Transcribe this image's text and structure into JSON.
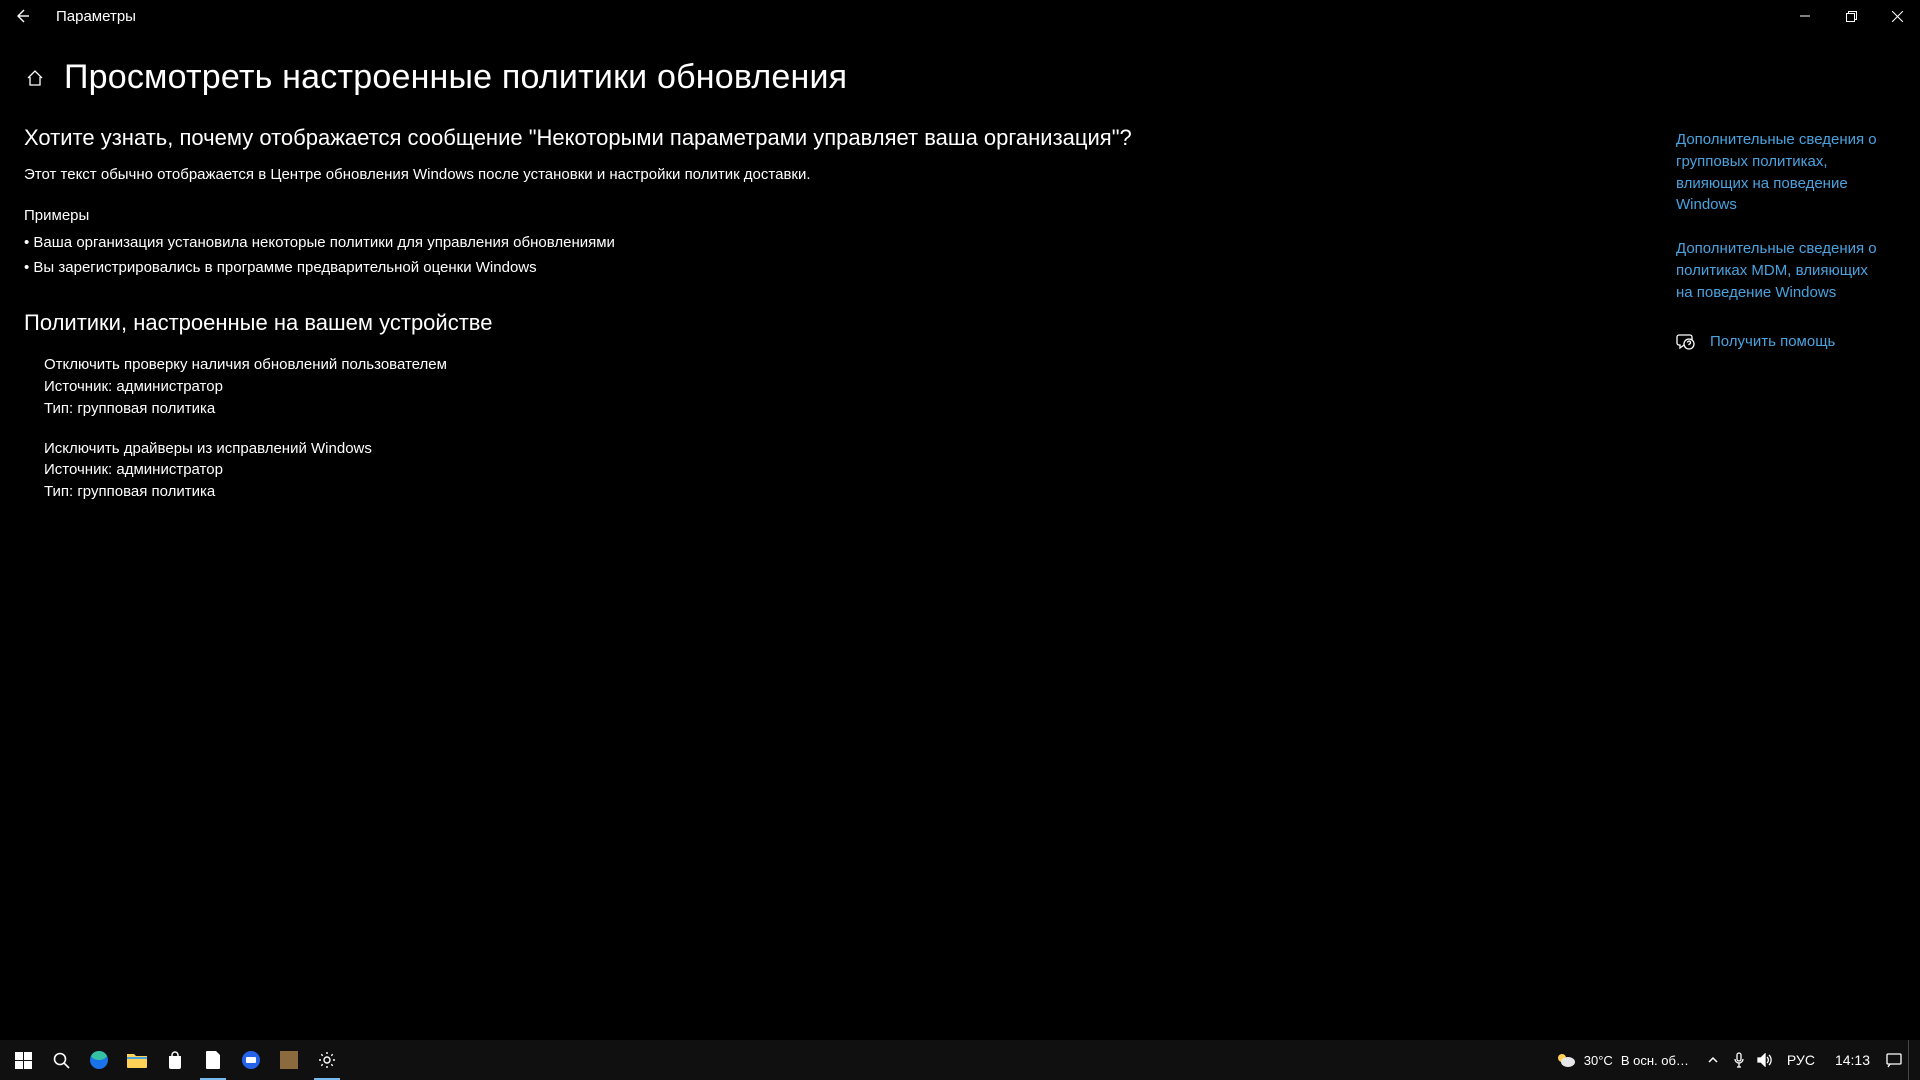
{
  "window": {
    "app_title": "Параметры"
  },
  "page": {
    "title": "Просмотреть настроенные политики обновления",
    "question": "Хотите узнать, почему отображается сообщение \"Некоторыми параметрами управляет ваша организация\"?",
    "explain": "Этот текст обычно отображается в Центре обновления Windows после установки и настройки политик доставки.",
    "examples_label": "Примеры",
    "examples": [
      "Ваша организация установила некоторые политики для управления обновлениями",
      "Вы зарегистрировались в программе предварительной оценки Windows"
    ],
    "policies_heading": "Политики, настроенные на вашем устройстве",
    "policies": [
      {
        "name": "Отключить проверку наличия обновлений пользователем",
        "source": "Источник: администратор",
        "type": "Тип: групповая политика"
      },
      {
        "name": "Исключить драйверы из исправлений Windows",
        "source": "Источник: администратор",
        "type": "Тип: групповая политика"
      }
    ]
  },
  "side": {
    "link_group": "Дополнительные сведения о групповых политиках, влияющих на поведение Windows",
    "link_mdm": "Дополнительные сведения о политиках MDM, влияющих на поведение Windows",
    "help": "Получить помощь"
  },
  "taskbar": {
    "weather_temp": "30°C",
    "weather_text": "В осн. об…",
    "lang": "РУС",
    "time": "14:13"
  }
}
